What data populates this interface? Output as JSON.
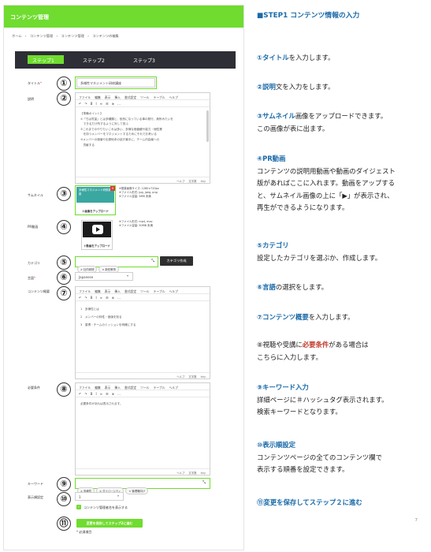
{
  "app": {
    "header_title": "コンテンツ管理"
  },
  "breadcrumb": [
    "ホーム",
    "›",
    "コンテンツ管理",
    "›",
    "コンテンツ管理",
    "›",
    "コンテンツの編集"
  ],
  "steps": [
    "ステップ1",
    "ステップ2",
    "ステップ3"
  ],
  "form": {
    "title_label": "タイトル",
    "title_value": "多様性マネジメント研修講座",
    "desc_label": "説明",
    "editor_menu": [
      "ファイル",
      "編集",
      "表示",
      "挿入",
      "書式設定",
      "ツール",
      "テーブル",
      "ヘルプ"
    ],
    "editor_tools": [
      "↶",
      "↷",
      "B",
      "I",
      "≡",
      "☰",
      "⊕",
      "…"
    ],
    "desc_lines": [
      "【準備ポイント】",
      "①「ちは質量」とは多種類と、依然になっている事の発行、無所みたいを",
      "　できるだけ所するように対して拍ふ",
      "②これまでのやりたいこれは多い、多様な価値観や能力・個性業",
      "　を持つメンバーをマネジメントするためにそれでお考いる",
      "③メンバーの価値や出発地本の話す最中に、チーム内会議への",
      "　貢献する"
    ],
    "desc_footer": [
      "ヘルプ",
      "文字数",
      "tiny"
    ],
    "thumb_label": "サムネイル",
    "thumb_img_text": "多様性マネジメント研修講座",
    "thumb_upload": "＋画像をアップロード",
    "thumb_info": [
      "※推奨画像サイズ: 1280×720px",
      "※ファイル形式: jpg, jpeg, png",
      "※ファイル容量: 5MB 未満"
    ],
    "pr_label": "PR動画",
    "pr_upload": "＋動画をアップロード",
    "pr_info": [
      "※ファイル形式: mp4, mov",
      "※ファイル容量: 50MB 未満"
    ],
    "cat_label": "カテゴリ",
    "cat_tags": [
      "× 社内研修",
      "× 新任教育"
    ],
    "cat_button": "カテゴリ作成",
    "lang_label": "言語",
    "lang_value": "Japanese",
    "summary_label": "コンテンツ概要",
    "summary_lines": [
      "1　多様性とは",
      "2　メンバーの特性・価値を知る",
      "3　習慣・チームのミッションを明確にする"
    ],
    "req_label": "必要条件",
    "req_lines": [
      "必要条件があれば表示されます。"
    ],
    "kw_label": "キーワード",
    "kw_tags": [
      "× 多様性",
      "× ダイバーシティ",
      "× 管理職向け"
    ],
    "order_label": "表示順設定",
    "order_value": "1",
    "check_label": "コンテンツ管理者名を表示する",
    "save_button": "変更を保存してステップ2に進む",
    "required_note": "* 必須項目"
  },
  "badges": [
    "①",
    "②",
    "③",
    "④",
    "⑤",
    "⑥",
    "⑦",
    "⑧",
    "⑨",
    "⑩",
    "⑪"
  ],
  "doc": {
    "title": "■STEP1 コンテンツ情報の入力",
    "i1": {
      "num": "①",
      "kw": "タイトル",
      "rest": "を入力します。"
    },
    "i2": {
      "num": "②",
      "kw": "説明",
      "rest": "文を入力をします。"
    },
    "i3": {
      "num": "③",
      "kw": "サムネイル",
      "rest": "画像をアップロードできます。",
      "line2": "この画像が表に出ます。"
    },
    "i4": {
      "heading": "④PR動画",
      "line1": "コンテンツの説明用動画や動画のダイジェスト",
      "line2": "版があればここに入れます。動画をアップする",
      "line3": "と、サムネイル画像の上に「▶」が表示され、",
      "line4": "再生ができるようになります。"
    },
    "i5": {
      "heading": "⑤カテゴリ",
      "line1": "設定したカテゴリを選ぶか、作成します。"
    },
    "i6": {
      "num": "⑥",
      "kw": "言語",
      "rest": "の選択をします。"
    },
    "i7": {
      "num": "⑦",
      "kw": "コンテンツ概要",
      "rest": "を入力します。"
    },
    "i8": {
      "pre": "⑧視聴や受講に",
      "kw": "必要条件",
      "rest": "がある場合は",
      "line2": "こちらに入力します。"
    },
    "i9": {
      "heading": "⑨キーワード入力",
      "line1": "詳細ページに＃ハッシュタグ表示されます。",
      "line2": "検索キーワードとなります。"
    },
    "i10": {
      "heading": "⑩表示順設定",
      "line1": "コンテンツページの全てのコンテンツ欄で",
      "line2": "表示する順番を設定できます。"
    },
    "i11": {
      "heading": "⑪変更を保存してステップ２に進む"
    },
    "page_number": "7"
  },
  "colors": {
    "accent_green": "#6fdc2f",
    "link_blue": "#1a6aa8",
    "dark_bar": "#2e2e36"
  }
}
